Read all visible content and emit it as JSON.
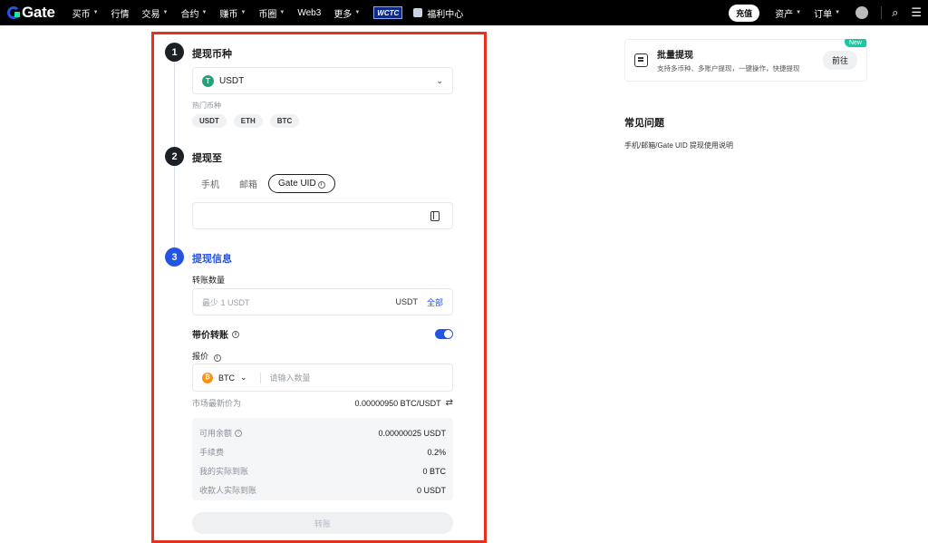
{
  "nav": {
    "logo": "Gate",
    "items": [
      "买币",
      "行情",
      "交易",
      "合约",
      "赚币",
      "币圈",
      "Web3",
      "更多"
    ],
    "carets": [
      true,
      false,
      true,
      true,
      true,
      true,
      false,
      true
    ],
    "wctc": "WCTC",
    "welfare": "福利中心",
    "deposit": "充值",
    "assets": "资产",
    "orders": "订单"
  },
  "form": {
    "step1": {
      "num": "1",
      "title": "提现币种"
    },
    "coin_selected": "USDT",
    "hot_label": "热门币种",
    "hot_coins": [
      "USDT",
      "ETH",
      "BTC"
    ],
    "step2": {
      "num": "2",
      "title": "提现至"
    },
    "tabs": [
      "手机",
      "邮箱",
      "Gate UID"
    ],
    "step3": {
      "num": "3",
      "title": "提现信息"
    },
    "amount_label": "转账数量",
    "amount_placeholder": "最少 1 USDT",
    "amount_unit": "USDT",
    "amount_all": "全部",
    "price_transfer_label": "带价转账",
    "quote_label": "报价",
    "quote_coin": "BTC",
    "quote_placeholder": "请输入数量",
    "market_label": "市场最新价为",
    "market_value": "0.00000950 BTC/USDT",
    "summary": [
      {
        "k": "可用余额",
        "v": "0.00000025 USDT"
      },
      {
        "k": "手续费",
        "v": "0.2%"
      },
      {
        "k": "我的实际到账",
        "v": "0 BTC"
      },
      {
        "k": "收款人实际到账",
        "v": "0 USDT"
      }
    ],
    "submit": "转账"
  },
  "side": {
    "batch_title": "批量提现",
    "batch_desc": "支持多币种、多账户提现，一键操作，快捷提现",
    "batch_go": "前往",
    "new_badge": "New",
    "faq_title": "常见问题",
    "faq_link": "手机/邮箱/Gate UID 提现使用说明"
  },
  "colors": {
    "accent": "#2354e6",
    "highlight_frame": "#e8301c",
    "usdt": "#26a17b",
    "btc": "#f7931a"
  }
}
